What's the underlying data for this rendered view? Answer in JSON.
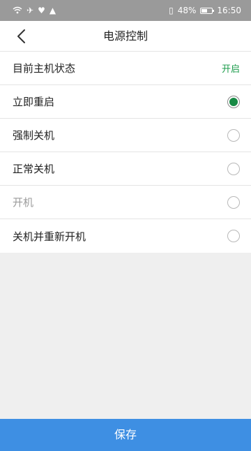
{
  "statusbar": {
    "battery": "48%",
    "time": "16:50"
  },
  "header": {
    "title": "电源控制"
  },
  "current_status": {
    "label": "目前主机状态",
    "value": "开启"
  },
  "options": [
    {
      "label": "立即重启",
      "checked": true,
      "disabled": false
    },
    {
      "label": "强制关机",
      "checked": false,
      "disabled": false
    },
    {
      "label": "正常关机",
      "checked": false,
      "disabled": false
    },
    {
      "label": "开机",
      "checked": false,
      "disabled": true
    },
    {
      "label": "关机并重新开机",
      "checked": false,
      "disabled": false
    }
  ],
  "footer": {
    "save_label": "保存"
  },
  "colors": {
    "accent_blue": "#3e8fe3",
    "status_green": "#1a9b4a",
    "radio_green": "#188a45",
    "statusbar_gray": "#9a9a9a"
  }
}
